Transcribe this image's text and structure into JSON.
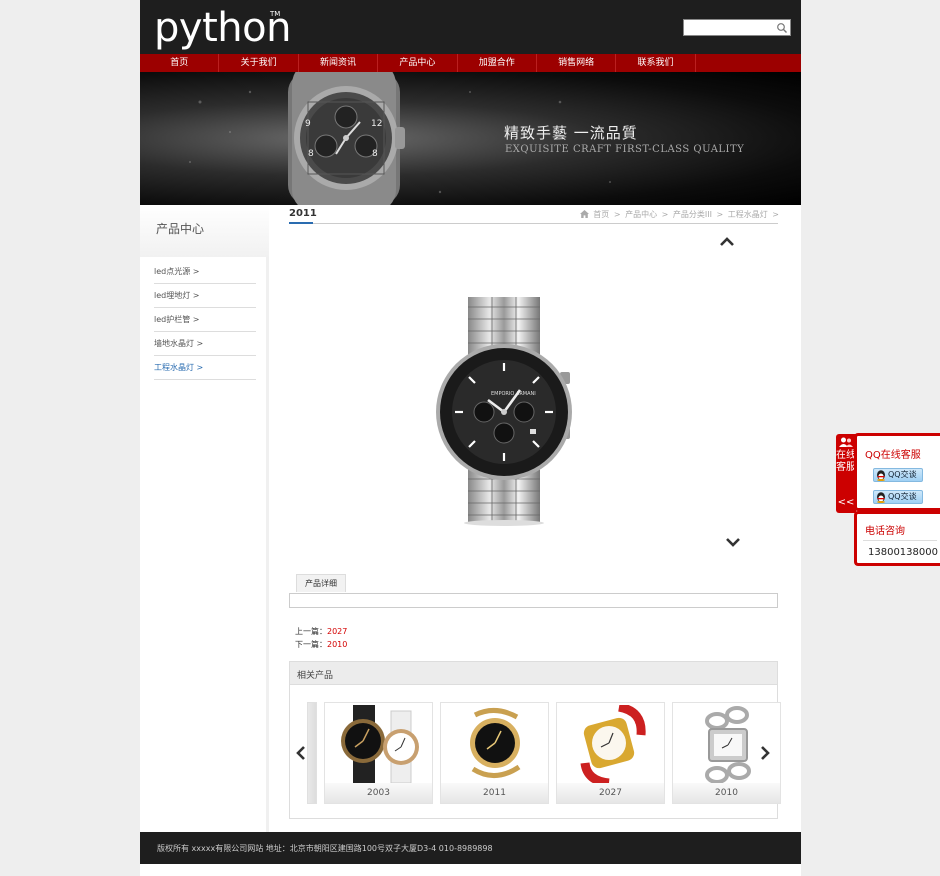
{
  "header": {
    "logo": "python",
    "tm": "TM",
    "search_placeholder": ""
  },
  "nav": [
    "首页",
    "关于我们",
    "新闻资讯",
    "产品中心",
    "加盟合作",
    "销售网络",
    "联系我们"
  ],
  "banner": {
    "title": "精致手藝 一流品質",
    "subtitle": "EXQUISITE CRAFT FIRST-CLASS QUALITY"
  },
  "sidebar": {
    "title": "产品中心",
    "items": [
      {
        "label": "led点光源 >",
        "active": false
      },
      {
        "label": "led埋地灯 >",
        "active": false
      },
      {
        "label": "led护栏管 >",
        "active": false
      },
      {
        "label": "墙地水晶灯 >",
        "active": false
      },
      {
        "label": "工程水晶灯 >",
        "active": true
      }
    ]
  },
  "main": {
    "title": "2011",
    "breadcrumb": [
      "首页",
      ">",
      "产品中心",
      ">",
      "产品分类III",
      ">",
      "工程水晶灯",
      ">"
    ],
    "tab_label": "产品详细",
    "prev_label": "上一篇：",
    "prev_value": "2027",
    "next_label": "下一篇：",
    "next_value": "2010"
  },
  "related": {
    "title": "相关产品",
    "items": [
      "2003",
      "2011",
      "2027",
      "2010"
    ]
  },
  "footer": {
    "text": "版权所有 xxxxx有限公司网站 地址：北京市朝阳区建国路100号双子大厦D3-4 010-8989898"
  },
  "float": {
    "tab_text": "在线客服",
    "tab_arrow": "<<",
    "qq_title": "QQ在线客服",
    "qq_buttons": [
      "QQ交谈",
      "QQ交谈"
    ],
    "phone_title": "电话咨询",
    "phone_number": "13800138000"
  },
  "colors": {
    "accent": "#9c0000",
    "float": "#cc0000",
    "link": "#2a6cb0",
    "header": "#1e1e1e"
  }
}
